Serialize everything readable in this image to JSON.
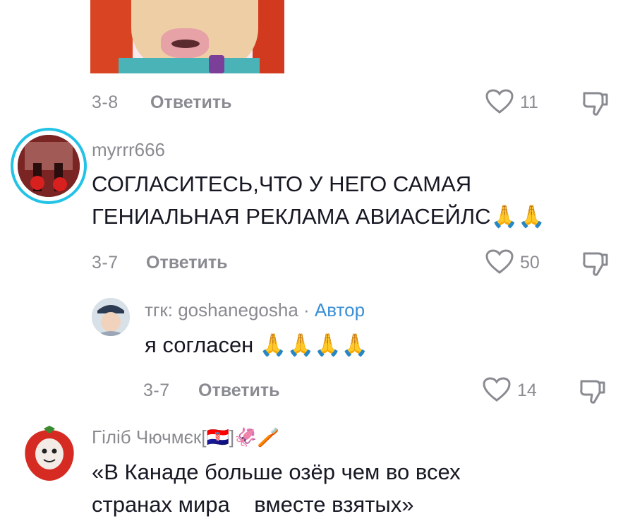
{
  "comments": [
    {
      "date": "3-8",
      "reply_label": "Ответить",
      "likes": "11"
    },
    {
      "username": "myrrr666",
      "text_line1": "СОГЛАСИТЕСЬ,ЧТО У НЕГО САМАЯ",
      "text_line2": "ГЕНИАЛЬНАЯ РЕКЛАМА АВИАСЕЙЛС🙏🙏",
      "date": "3-7",
      "reply_label": "Ответить",
      "likes": "50"
    },
    {
      "username": "тгк: goshanegosha · ",
      "author_badge": "Автор",
      "text": "я согласен 🙏🙏🙏🙏",
      "date": "3-7",
      "reply_label": "Ответить",
      "likes": "14"
    },
    {
      "username": "Гіліб Чючмєк[🇭🇷]🦑🪥",
      "text_line1": "«В Канаде больше озёр чем во всех",
      "text_line2": "странах мира    вместе взятых»"
    }
  ],
  "icons": {
    "like": "heart-outline-icon",
    "dislike": "thumbs-down-outline-icon"
  },
  "colors": {
    "author_badge": "#3a8fd6",
    "story_ring": "#22c3e6"
  }
}
